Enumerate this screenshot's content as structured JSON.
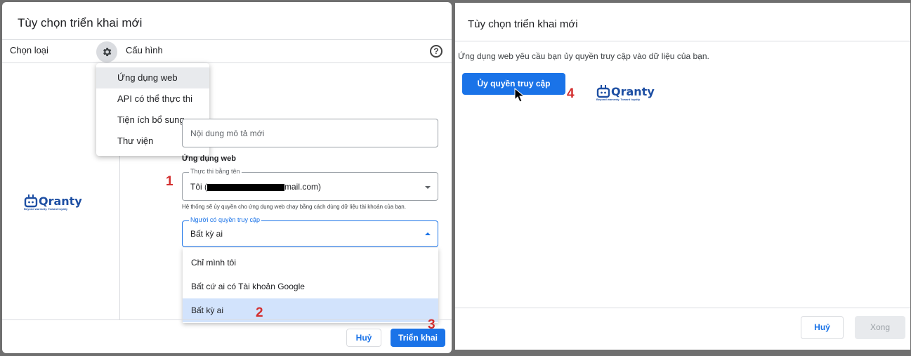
{
  "left_dialog": {
    "title": "Tùy chọn triển khai mới",
    "tab_select_type": "Chọn loại",
    "tab_config": "Cấu hình",
    "help_glyph": "?",
    "type_menu": [
      "Ứng dụng web",
      "API có thể thực thi",
      "Tiện ích bổ sung",
      "Thư viện"
    ],
    "description_placeholder": "Nội dung mô tả mới",
    "section_label": "Ứng dụng web",
    "execute_as": {
      "label": "Thực thi bằng tên",
      "value_prefix": "Tôi (",
      "value_suffix": "mail.com)"
    },
    "helper_text": "Hệ thống sẽ ủy quyền cho ứng dụng web chạy bằng cách dùng dữ liệu tài khoản của bạn.",
    "access": {
      "label": "Người có quyền truy cập",
      "value": "Bất kỳ ai"
    },
    "access_options": [
      "Chỉ mình tôi",
      "Bất cứ ai có Tài khoản Google",
      "Bất kỳ ai"
    ],
    "selected_option_index": 2,
    "cancel_label": "Huỷ",
    "deploy_label": "Triển khai"
  },
  "right_dialog": {
    "title": "Tùy chọn triển khai mới",
    "message": "Ứng dụng web yêu cầu bạn ủy quyền truy cập vào dữ liệu của bạn.",
    "authorize_label": "Ủy quyền truy cập",
    "cancel_label": "Huỷ",
    "done_label": "Xong"
  },
  "step_numbers": [
    "1",
    "2",
    "3",
    "4"
  ],
  "logo": {
    "name": "Qranty",
    "tagline": "Beyond warranty. Toward loyalty"
  },
  "colors": {
    "primary": "#1a73e8",
    "selected_option": "#d2e3fc",
    "step_number": "#d32f2f",
    "logo": "#1e4fa3"
  },
  "icons": [
    "gear-icon",
    "help-icon",
    "dropdown-arrow-icon",
    "cursor-icon",
    "logo-icon"
  ]
}
